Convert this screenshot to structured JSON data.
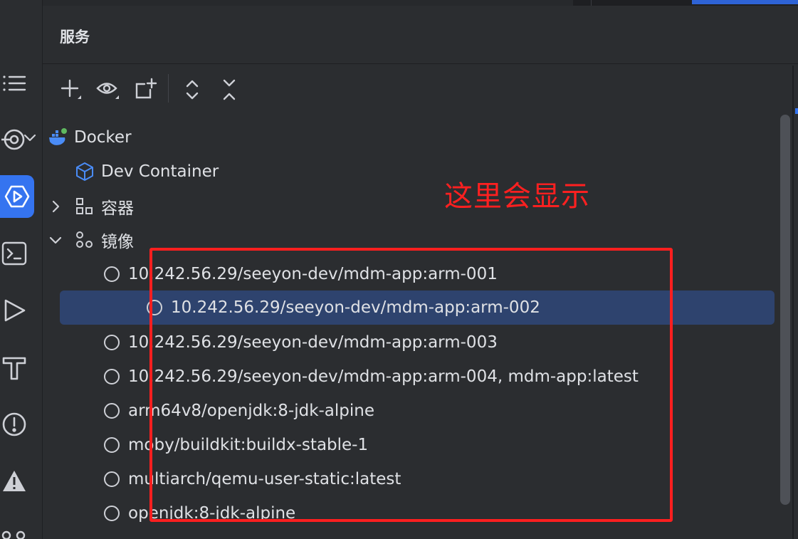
{
  "panel": {
    "title": "服务"
  },
  "toolbar": {
    "buttons": [
      {
        "name": "add-service-button",
        "icon": "plus-icon"
      },
      {
        "name": "view-options-button",
        "icon": "eye-icon"
      },
      {
        "name": "new-tab-button",
        "icon": "add-tab-icon"
      },
      {
        "name": "expand-all-button",
        "icon": "expand-all-icon"
      },
      {
        "name": "collapse-all-button",
        "icon": "collapse-all-icon"
      }
    ]
  },
  "tree": {
    "docker": {
      "label": "Docker",
      "expanded": true
    },
    "dev_container": {
      "label": "Dev Container"
    },
    "containers": {
      "label": "容器",
      "expanded": false
    },
    "images": {
      "label": "镜像",
      "expanded": true
    },
    "image_items": [
      {
        "label": "10.242.56.29/seeyon-dev/mdm-app:arm-001",
        "selected": false
      },
      {
        "label": "10.242.56.29/seeyon-dev/mdm-app:arm-002",
        "selected": true
      },
      {
        "label": "10.242.56.29/seeyon-dev/mdm-app:arm-003",
        "selected": false
      },
      {
        "label": "10.242.56.29/seeyon-dev/mdm-app:arm-004, mdm-app:latest",
        "selected": false
      },
      {
        "label": "arm64v8/openjdk:8-jdk-alpine",
        "selected": false
      },
      {
        "label": "moby/buildkit:buildx-stable-1",
        "selected": false
      },
      {
        "label": "multiarch/qemu-user-static:latest",
        "selected": false
      },
      {
        "label": "openjdk:8-jdk-alpine",
        "selected": false
      }
    ]
  },
  "annotation": {
    "text": "这里会显示"
  },
  "colors": {
    "background": "#2b2d30",
    "selection": "#2e436e",
    "accent": "#3574f0",
    "annotation_red": "#ff1f1f",
    "docker_blue": "#4a8cf7"
  }
}
